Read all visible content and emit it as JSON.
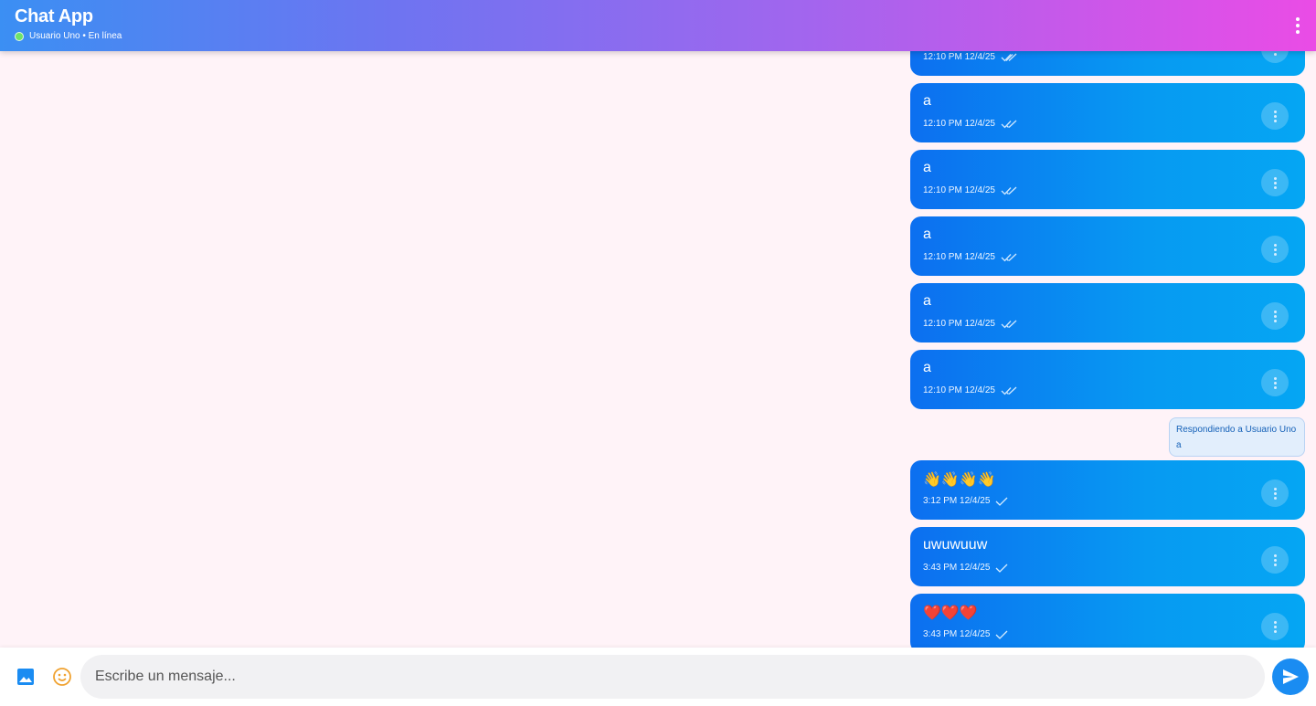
{
  "header": {
    "title": "Chat App",
    "status": "Usuario Uno • En línea",
    "menu_icon": "more-vert-icon"
  },
  "messages": [
    {
      "text": "",
      "time": "12:10 PM 12/4/25",
      "receipt": "double-check"
    },
    {
      "text": "a",
      "time": "12:10 PM 12/4/25",
      "receipt": "double-check"
    },
    {
      "text": "a",
      "time": "12:10 PM 12/4/25",
      "receipt": "double-check"
    },
    {
      "text": "a",
      "time": "12:10 PM 12/4/25",
      "receipt": "double-check"
    },
    {
      "text": "a",
      "time": "12:10 PM 12/4/25",
      "receipt": "double-check"
    },
    {
      "text": "a",
      "time": "12:10 PM 12/4/25",
      "receipt": "double-check"
    },
    {
      "text": "👋👋👋👋",
      "time": "3:12 PM 12/4/25",
      "receipt": "single-check"
    },
    {
      "text": "uwuwuuw",
      "time": "3:43 PM 12/4/25",
      "receipt": "single-check"
    },
    {
      "text": "❤️❤️❤️",
      "time": "3:43 PM 12/4/25",
      "receipt": "single-check"
    }
  ],
  "reply_preview": {
    "title": "Respondiendo a Usuario Uno",
    "text": "a"
  },
  "composer": {
    "placeholder": "Escribe un mensaje...",
    "image_icon": "image-icon",
    "emoji_icon": "emoji-icon",
    "send_icon": "send-icon"
  },
  "colors": {
    "bubble": "#0a8af1",
    "accent": "#1a8cf2",
    "online": "#6ee36a"
  }
}
